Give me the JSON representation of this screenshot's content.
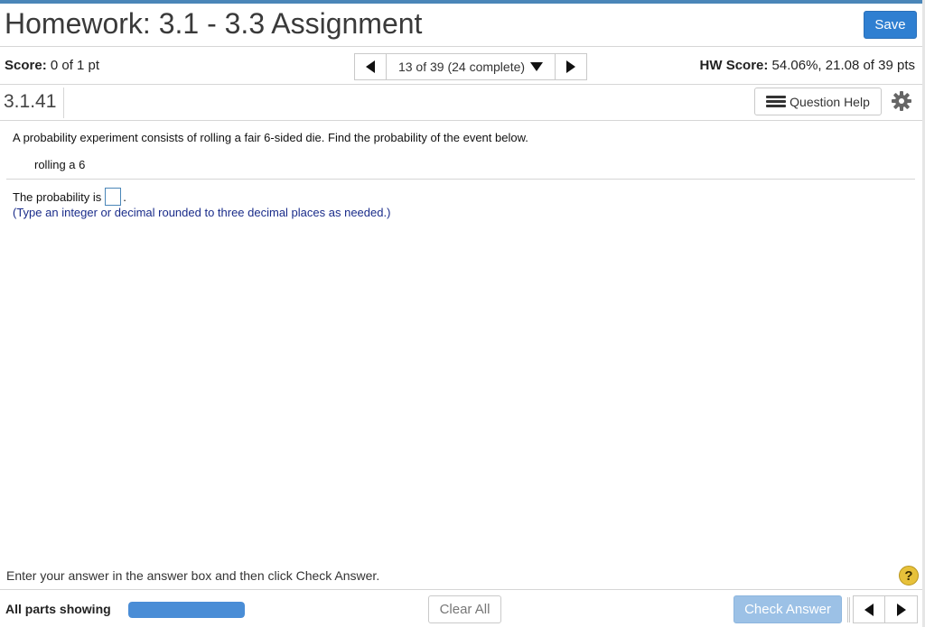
{
  "header": {
    "title": "Homework: 3.1 - 3.3 Assignment",
    "save_label": "Save",
    "accent_color": "#2f7fd1"
  },
  "score_bar": {
    "score_label": "Score:",
    "score_value": "0 of 1 pt",
    "question_position": "13 of 39 (24 complete)",
    "hw_score_label": "HW Score:",
    "hw_score_value": "54.06%, 21.08 of 39 pts"
  },
  "question_header": {
    "number": "3.1.41",
    "help_label": "Question Help",
    "help_icon": "list-icon",
    "settings_icon": "gear-icon"
  },
  "question": {
    "prompt": "A probability experiment consists of rolling a fair 6-sided die. Find the probability of the event below.",
    "event": "rolling a 6",
    "answer_prefix": "The probability is",
    "answer_value": "",
    "answer_suffix": ".",
    "hint": "(Type an integer or decimal rounded to three decimal places as needed.)"
  },
  "footer": {
    "instruction": "Enter your answer in the answer box and then click Check Answer.",
    "help_glyph": "?",
    "parts_label": "All parts showing",
    "parts_progress_fraction": 1.0,
    "clear_label": "Clear All",
    "check_label": "Check Answer"
  }
}
